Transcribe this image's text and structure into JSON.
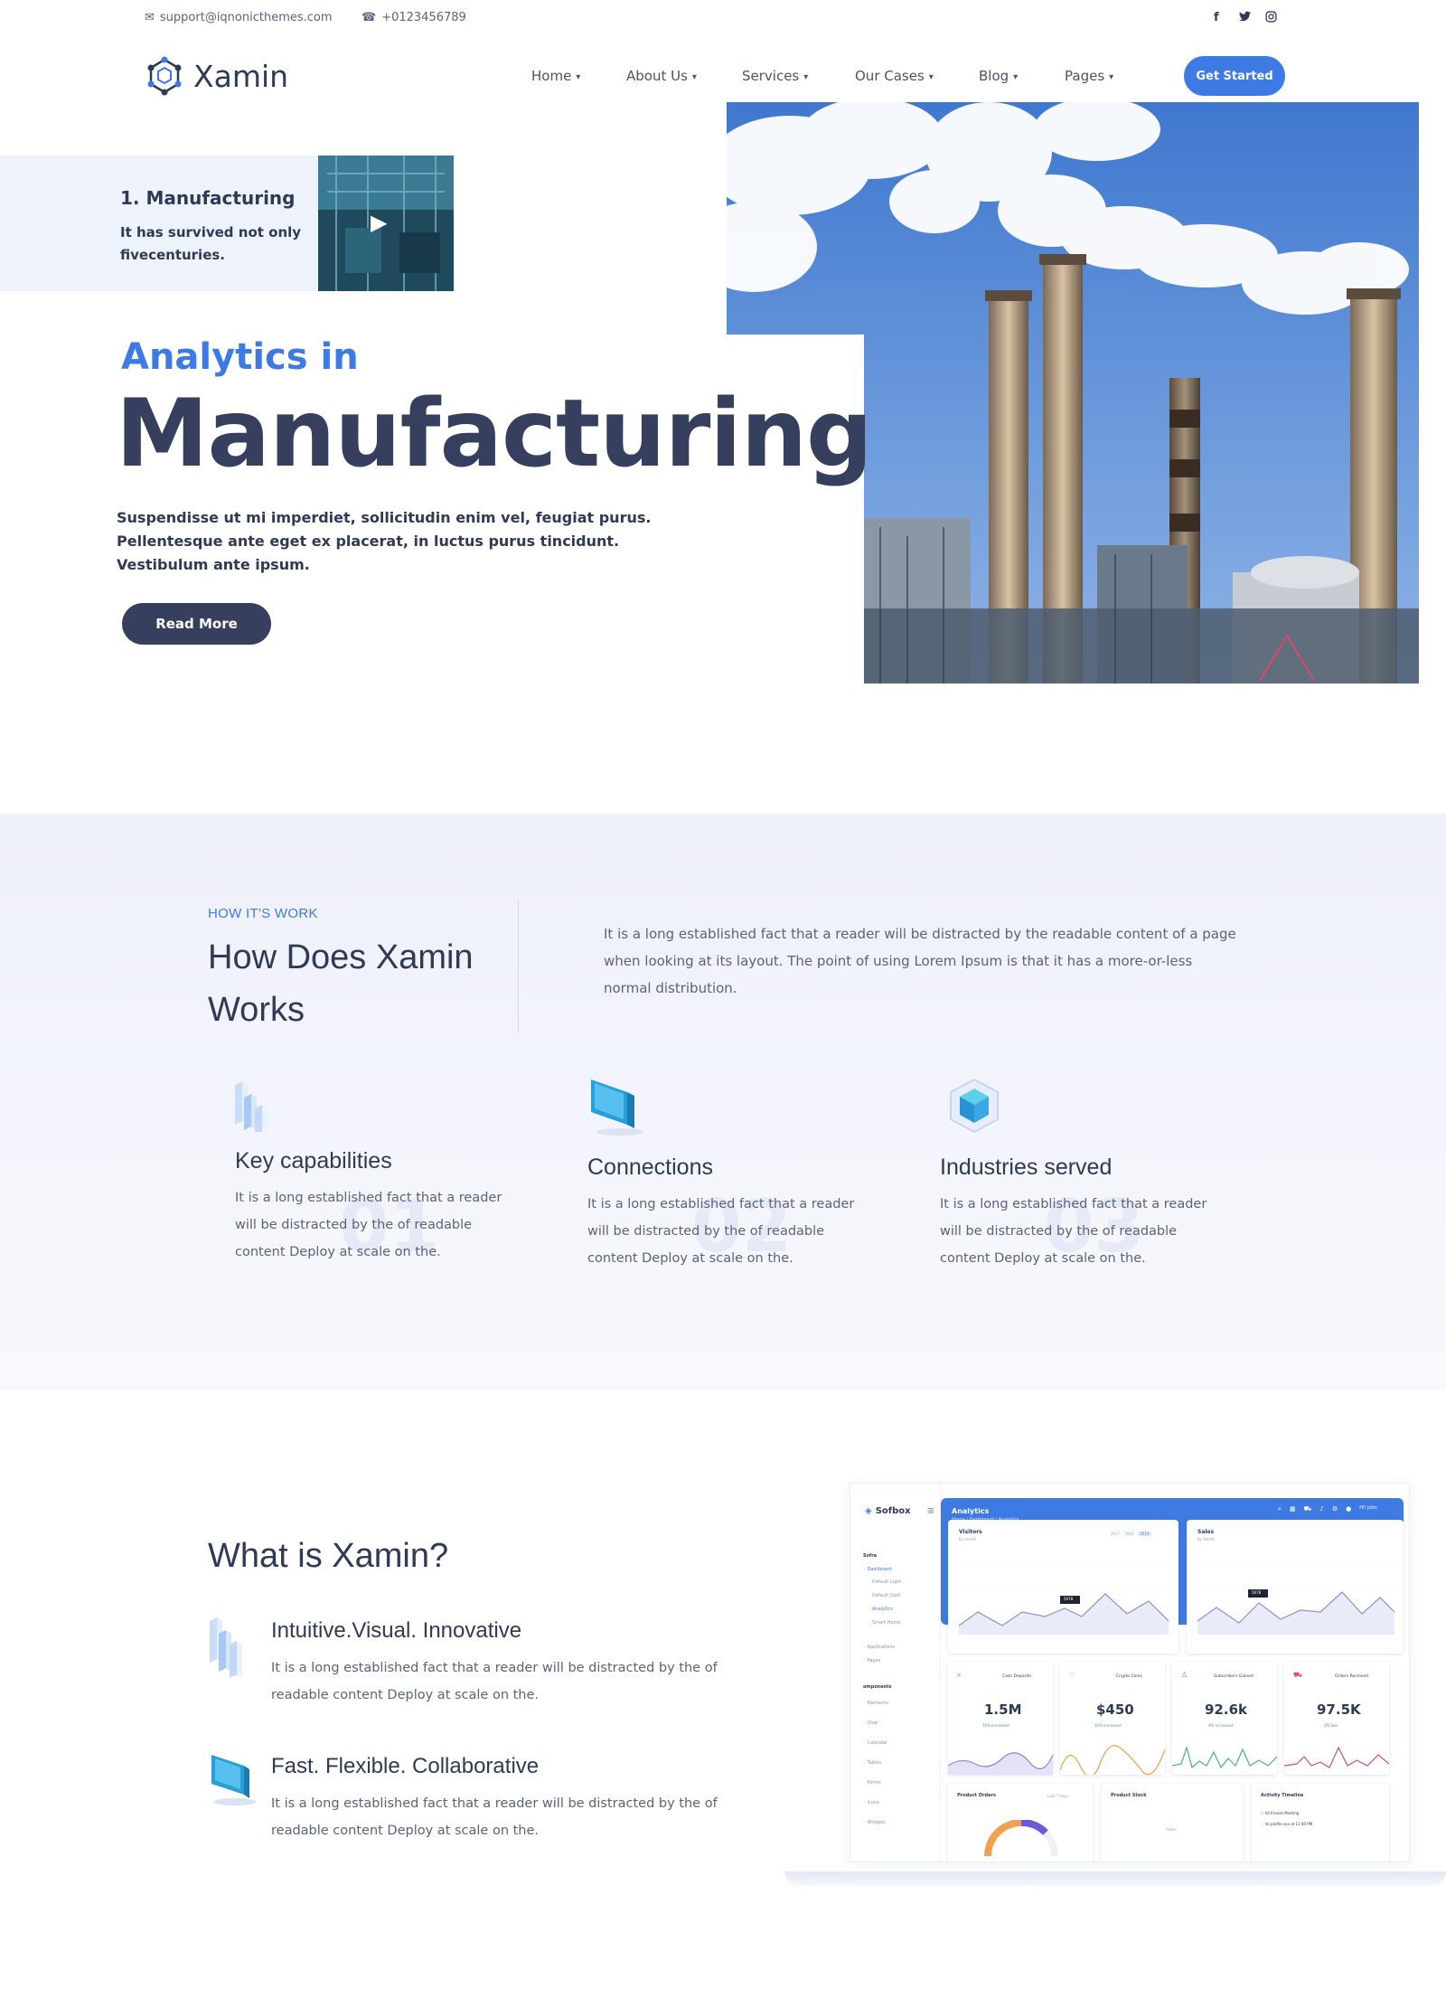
{
  "topbar": {
    "email": "support@iqnonicthemes.com",
    "phone": "+0123456789",
    "social": [
      "facebook-icon",
      "twitter-icon",
      "instagram-icon"
    ]
  },
  "header": {
    "brand": "Xamin",
    "nav": [
      "Home",
      "About Us",
      "Services",
      "Our Cases",
      "Blog",
      "Pages"
    ],
    "cta": "Get Started"
  },
  "hero": {
    "video_title": "1. Manufacturing",
    "video_desc": "It has survived not only fivecenturies.",
    "subtitle": "Analytics in",
    "title": "Manufacturing",
    "description": "Suspendisse ut mi imperdiet, sollicitudin enim vel, feugiat purus. Pellentesque ante eget ex placerat, in luctus purus tincidunt. Vestibulum ante ipsum.",
    "button": "Read More"
  },
  "how": {
    "kicker": "HOW IT'S WORK",
    "title": "How Does Xamin Works",
    "description": "It is a long established fact that a reader will be distracted by the readable content of a page when looking at its layout. The point of using Lorem Ipsum is that it has a more-or-less normal distribution.",
    "features": [
      {
        "number": "01",
        "title": "Key capabilities",
        "desc": "It is a long established fact that a reader will be distracted by the of readable content Deploy at scale on the."
      },
      {
        "number": "02",
        "title": "Connections",
        "desc": "It is a long established fact that a reader will be distracted by the of readable content Deploy at scale on the."
      },
      {
        "number": "03",
        "title": "Industries served",
        "desc": "It is a long established fact that a reader will be distracted by the of readable content Deploy at scale on the."
      }
    ]
  },
  "what": {
    "title": "What is Xamin?",
    "items": [
      {
        "title": "Intuitive.Visual. Innovative",
        "desc": "It is a long established fact that a reader will be distracted by the of readable content Deploy at scale on the."
      },
      {
        "title": "Fast. Flexible. Collaborative",
        "desc": "It is a long established fact that a reader will be distracted by the of readable content Deploy at scale on the."
      }
    ]
  },
  "dashboard": {
    "brand": "Sofbox",
    "page": "Analytics",
    "breadcrumb": "Home / Dashboard / Analytics",
    "side_section_1": "Sofra",
    "side_items": [
      "Dashboard",
      "Default Light",
      "Default Dark",
      "Analytics",
      "Smart Home"
    ],
    "side_more": [
      "Applications",
      "Pages"
    ],
    "side_section_2": "omponents",
    "side_items_2": [
      "Elements",
      "Chat",
      "Calendar",
      "Tables",
      "Forms",
      "Icons",
      "Widgets"
    ],
    "chart1_title": "Visitors",
    "chart1_sub": "By month",
    "chart1_tabs": [
      "2017",
      "2018",
      "2019"
    ],
    "chart2_title": "Sales",
    "chart2_sub": "By Month",
    "chart_tag": "5678",
    "kpis": [
      {
        "label": "Cash Deposits",
        "value": "1.5M",
        "sub": "10% increased"
      },
      {
        "label": "Crypto Coins",
        "value": "$450",
        "sub": "30% increased"
      },
      {
        "label": "Subscribers Gained",
        "value": "92.6k",
        "sub": "4% increased"
      },
      {
        "label": "Orders Received",
        "value": "97.5K",
        "sub": "2% loss"
      }
    ],
    "bottom": [
      "Product Orders",
      "Product Stock",
      "Activity Timeline"
    ],
    "bottom_filter": "Last 7 days",
    "bottom_stock_label": "Sales",
    "activity": [
      "All friends Meeting",
      "Ve profile xxx at 11:00 PM"
    ],
    "user": "Hi! John"
  }
}
